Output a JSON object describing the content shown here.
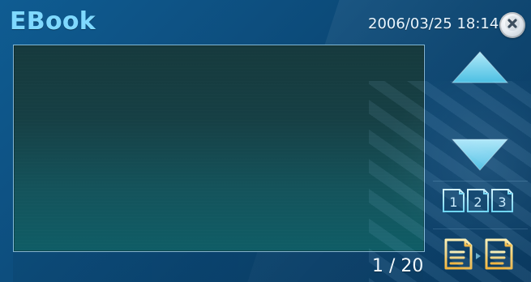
{
  "app": {
    "title": "EBook",
    "datetime": "2006/03/25 18:14"
  },
  "reader": {
    "page_indicator": "1 / 20"
  },
  "icons": {
    "close": "close-icon",
    "up": "arrow-up-icon",
    "down": "arrow-down-icon",
    "pages": "page-numbers-icon",
    "copy": "document-to-document-icon"
  },
  "pages_control": {
    "labels": [
      "1",
      "2",
      "3"
    ]
  }
}
